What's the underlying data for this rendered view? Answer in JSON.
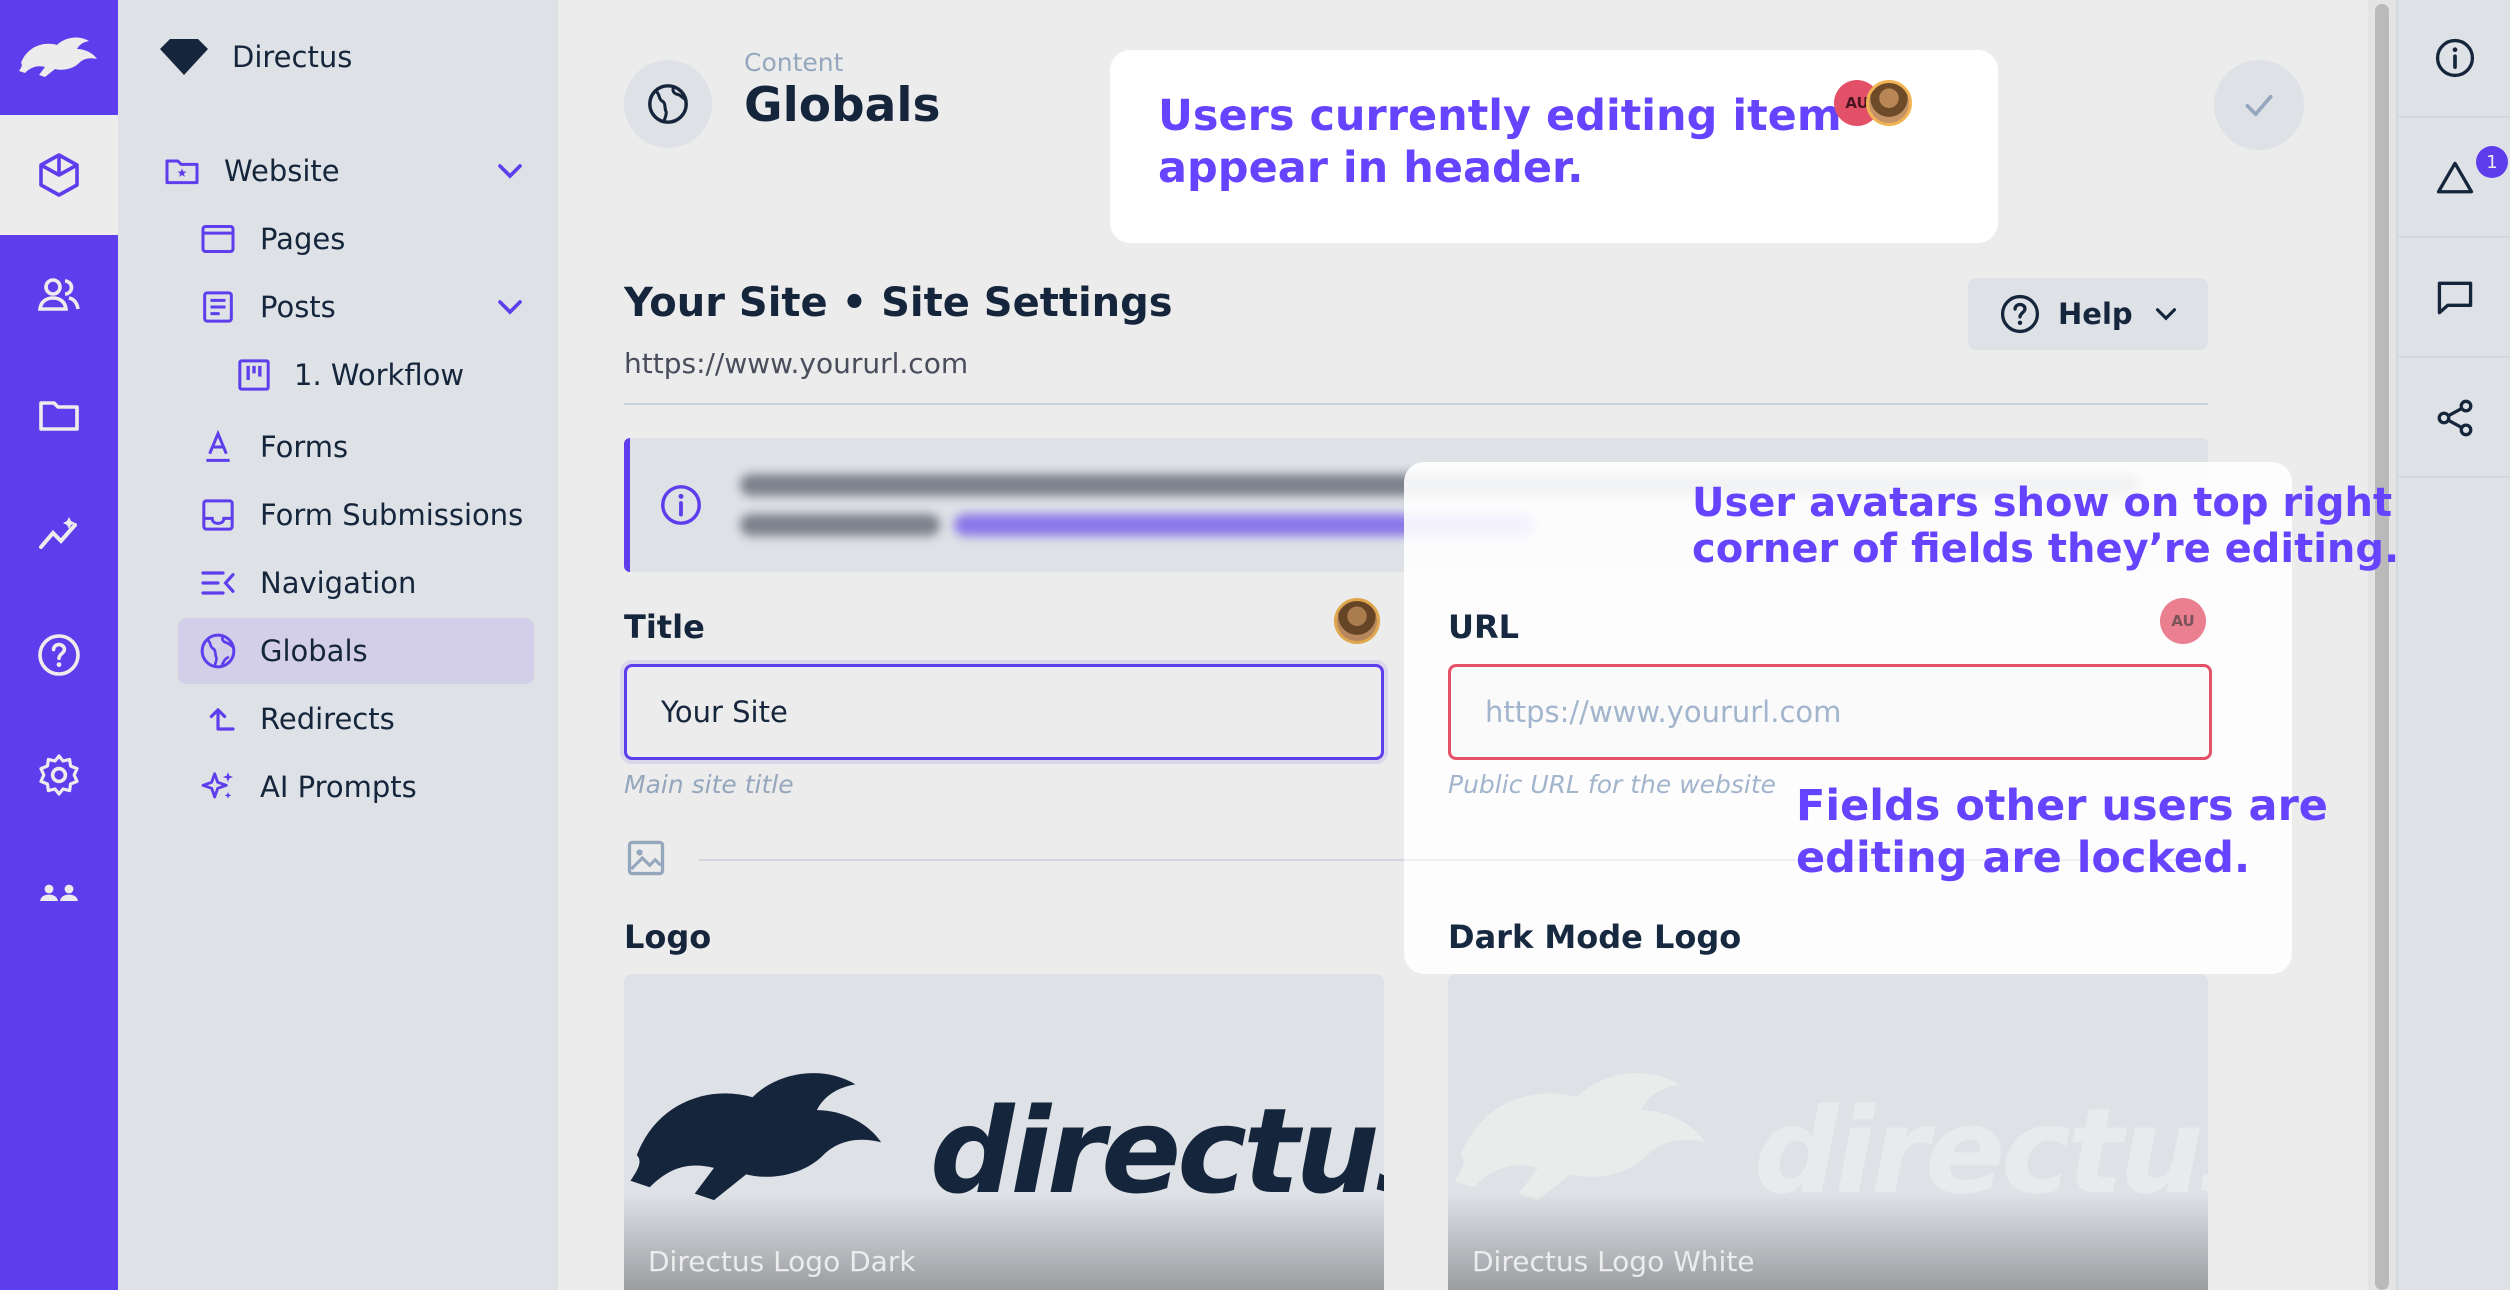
{
  "project": {
    "name": "Directus"
  },
  "modules": [
    {
      "icon": "cube-icon",
      "label": "Content"
    },
    {
      "icon": "users-icon",
      "label": "User Directory"
    },
    {
      "icon": "folder-icon",
      "label": "Files"
    },
    {
      "icon": "insights-icon",
      "label": "Insights"
    },
    {
      "icon": "help-icon",
      "label": "Help"
    },
    {
      "icon": "settings-icon",
      "label": "Settings"
    },
    {
      "icon": "groups-icon",
      "label": "Users"
    }
  ],
  "nav": {
    "items": [
      {
        "label": "Website",
        "icon": "folder-star-icon",
        "expanded": true
      },
      {
        "label": "Pages",
        "icon": "web-icon"
      },
      {
        "label": "Posts",
        "icon": "article-icon",
        "expanded": true
      },
      {
        "label": "1. Workflow",
        "icon": "kanban-icon"
      },
      {
        "label": "Forms",
        "icon": "text-format-icon"
      },
      {
        "label": "Form Submissions",
        "icon": "inbox-icon"
      },
      {
        "label": "Navigation",
        "icon": "menu-open-icon"
      },
      {
        "label": "Globals",
        "icon": "globe-icon",
        "active": true
      },
      {
        "label": "Redirects",
        "icon": "turn-right-icon"
      },
      {
        "label": "AI Prompts",
        "icon": "sparkles-icon"
      }
    ]
  },
  "header": {
    "breadcrumb": "Content",
    "title": "Globals"
  },
  "item": {
    "title": "Your Site • Site Settings",
    "subtitle": "https://www.yoururl.com",
    "help_label": "Help"
  },
  "fields": {
    "title": {
      "label": "Title",
      "value": "Your Site",
      "note": "Main site title"
    },
    "url": {
      "label": "URL",
      "placeholder": "https://www.yoururl.com",
      "note": "Public URL for the website",
      "avatar": "AU"
    },
    "logo": {
      "label": "Logo",
      "caption": "Directus Logo Dark",
      "wordmark": "directus"
    },
    "dark_logo": {
      "label": "Dark Mode Logo",
      "caption": "Directus Logo White",
      "wordmark": "directus"
    }
  },
  "header_presence": {
    "avatar": "AU"
  },
  "sidebar": {
    "notifications_count": "1"
  },
  "callouts": {
    "header": {
      "line1": "Users currently editing item",
      "line2": "appear in header."
    },
    "avatars": {
      "line1": "User avatars show on top right",
      "line2": "corner of fields they’re editing."
    },
    "locked": {
      "line1": "Fields other users are",
      "line2": "editing are locked."
    }
  },
  "colors": {
    "accent": "#6644ff",
    "danger": "#e35169",
    "background_subdued": "#f0f4f9"
  }
}
